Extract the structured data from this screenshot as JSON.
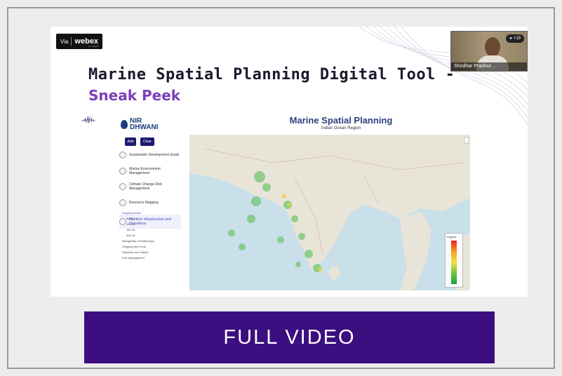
{
  "video": {
    "webex_via": "Via",
    "webex_brand": "webex",
    "webex_sub": "by CISCO",
    "title_line1": "Marine Spatial Planning Digital Tool -",
    "title_line2": "Sneak Peek",
    "participant_name": "Shridhar Prashur...",
    "participant_count": "+19",
    "app": {
      "logo_text_1": "NIR",
      "logo_text_2": "DHWANI",
      "title": "Marine Spatial Planning",
      "subtitle": "Indian Ocean Region",
      "add_label": "Add",
      "clear_label": "Clear",
      "sidebar": [
        {
          "label": "Sustainable Development Goals"
        },
        {
          "label": "Marine Environment Management"
        },
        {
          "label": "Climate Change Risk Management"
        },
        {
          "label": "Resource Mapping"
        },
        {
          "label": "Maritime Infrastructure and Operations"
        }
      ],
      "sublist": [
        "Shipping Noise",
        "50 Hz",
        "100 Hz",
        "160 Hz",
        "200 Hz",
        "Navigability of Waterways",
        "Shipping and Ports",
        "Pipelines and Cables",
        "Port Management"
      ],
      "legend_title": "Legend"
    }
  },
  "cta": {
    "label": "FULL VIDEO"
  },
  "colors": {
    "cta_bg": "#3b0f80",
    "accent_purple": "#7a3fb8",
    "background": "#ededed"
  }
}
